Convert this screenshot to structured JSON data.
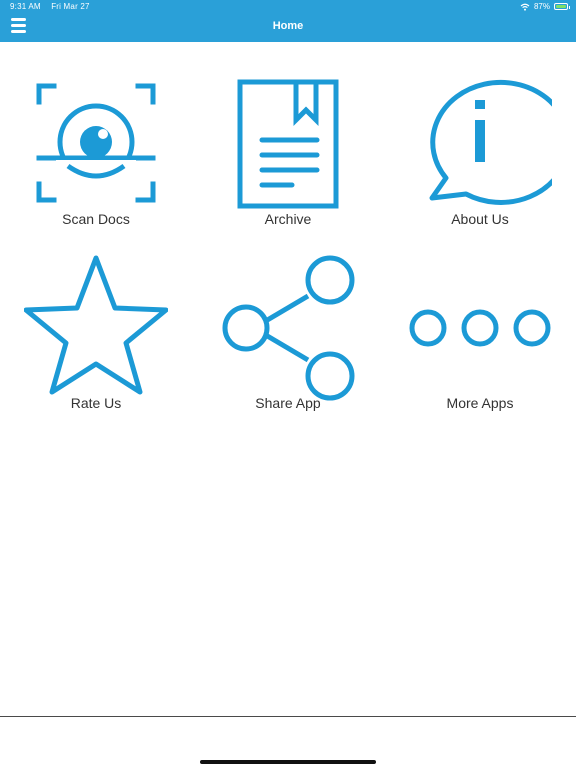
{
  "status_bar": {
    "time": "9:31 AM",
    "date": "Fri Mar 27",
    "battery": "87%",
    "battery_level": 0.87
  },
  "header": {
    "title": "Home",
    "menu_icon": "hamburger-menu-icon"
  },
  "tiles": [
    {
      "label": "Scan Docs",
      "icon": "scan-eye-icon"
    },
    {
      "label": "Archive",
      "icon": "document-bookmark-icon"
    },
    {
      "label": "About Us",
      "icon": "info-speech-bubble-icon"
    },
    {
      "label": "Rate Us",
      "icon": "star-icon"
    },
    {
      "label": "Share App",
      "icon": "share-icon"
    },
    {
      "label": "More Apps",
      "icon": "more-dots-icon"
    }
  ],
  "colors": {
    "accent": "#2aa0d8",
    "icon_stroke": "#1c9ad6",
    "label_text": "#333333"
  }
}
